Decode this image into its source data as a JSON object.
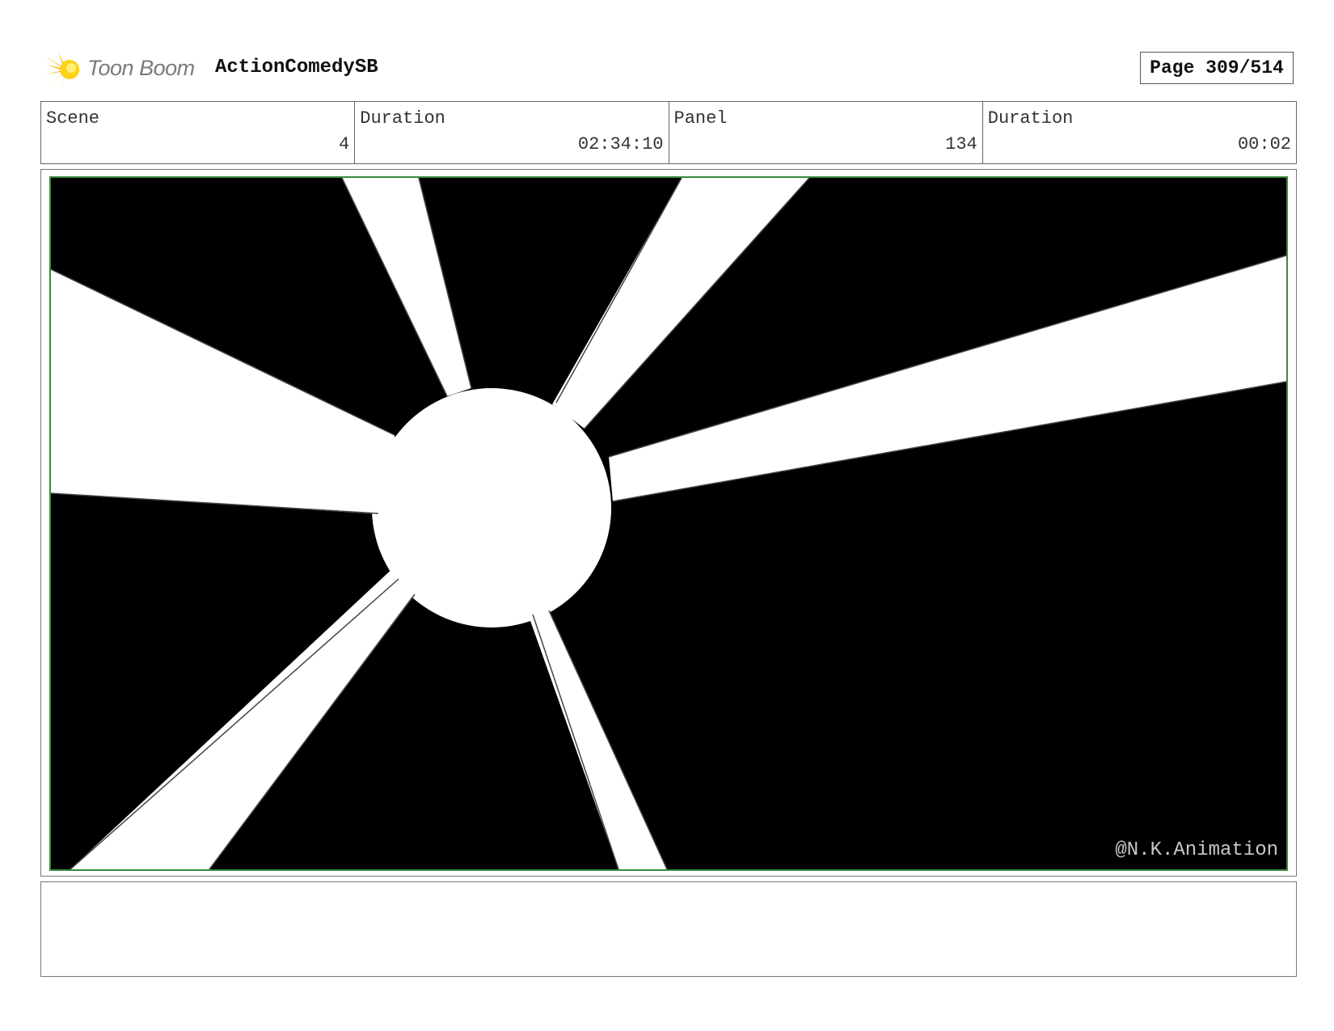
{
  "header": {
    "logo_text": "Toon Boom",
    "logo_icon": "toon-boom-star-icon",
    "project_title": "ActionComedySB",
    "page_label": "Page 309/514"
  },
  "info": {
    "scene_label": "Scene",
    "scene_value": "4",
    "scene_duration_label": "Duration",
    "scene_duration_value": "02:34:10",
    "panel_label": "Panel",
    "panel_value": "134",
    "panel_duration_label": "Duration",
    "panel_duration_value": "00:02"
  },
  "panel": {
    "watermark": "@N.K.Animation",
    "image_description_colors": {
      "background": "#000000",
      "rays": "#ffffff",
      "frame": "#3a8a3a"
    }
  },
  "notes": {
    "text": ""
  }
}
